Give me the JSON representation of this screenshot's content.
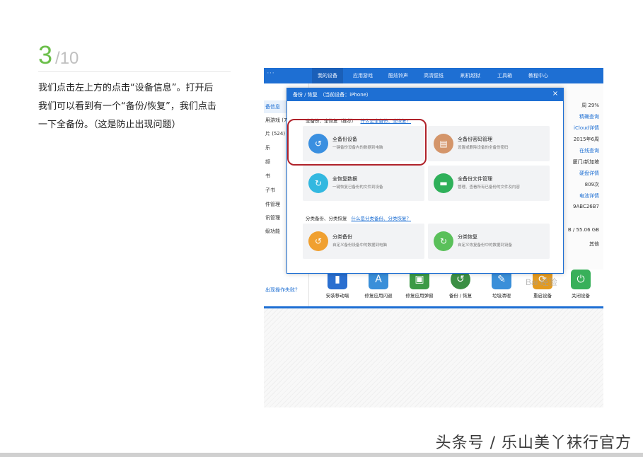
{
  "step": {
    "number": "3",
    "total": "/10"
  },
  "instruction_lines": [
    "我们点击左上方的点击“设备信息”。打开后",
    "我们可以看到有一个“备份/恢复”，我们点击",
    "一下全备份。（这是防止出现问题）"
  ],
  "app": {
    "nav": [
      "我的设备",
      "应用游戏",
      "酷炫铃声",
      "高清壁纸",
      "刷机越狱",
      "工具箱",
      "教程中心"
    ],
    "active_nav": "我的设备",
    "sidebar": [
      "备信息",
      "用游戏 (7...",
      "片 (524)",
      "乐",
      "频",
      "书",
      "子书",
      "件管理",
      "讯管理",
      "级功能"
    ],
    "sidebar_fail_link": "出现操作失败？",
    "right_info": [
      "周 29%",
      "精确查询",
      "iCloud详情",
      "2015年6周",
      "在线查询",
      "厦门/新加坡",
      "硬盘详情",
      "809次",
      "电池详情",
      "9ABC26B7",
      "B / 55.06 GB",
      "其他"
    ],
    "tools": [
      {
        "label": "安装移动端",
        "icon": "install-mobile-icon",
        "color": "#2a6fd0"
      },
      {
        "label": "修复应用闪退",
        "icon": "app-repair-icon",
        "color": "#3a8fd9"
      },
      {
        "label": "修复应用弹窗",
        "icon": "popup-repair-icon",
        "color": "#3c9a46"
      },
      {
        "label": "备份 / 恢复",
        "icon": "backup-restore-icon",
        "color": "#3b8f44"
      },
      {
        "label": "垃圾清理",
        "icon": "cleanup-icon",
        "color": "#3a8fd9"
      },
      {
        "label": "重启设备",
        "icon": "restart-icon",
        "color": "#e39a1f"
      },
      {
        "label": "关闭设备",
        "icon": "power-icon",
        "color": "#38b05a"
      }
    ]
  },
  "modal": {
    "title": "备份 / 恢复　（当前设备：iPhone）",
    "close": "×",
    "section1": {
      "label": "全备份、全恢复（推荐）",
      "help": "什么是全备份、全恢复？"
    },
    "section2": {
      "label": "分类备份、分类恢复",
      "help": "什么是分类备份、分类恢复？"
    },
    "cards": [
      {
        "title": "全备份设备",
        "desc": "一键备份设备内的数据到电脑",
        "icon": "full-backup-icon",
        "color": "#3a8fe0"
      },
      {
        "title": "全备份密码管理",
        "desc": "设置或删除设备的全备份密码",
        "icon": "password-lock-icon",
        "color": "#d4956a"
      },
      {
        "title": "全恢复数据",
        "desc": "一键恢复已备份的文件到设备",
        "icon": "full-restore-icon",
        "color": "#33b8e0"
      },
      {
        "title": "全备份文件管理",
        "desc": "管理、查看所有已备份的文件及内容",
        "icon": "folder-icon",
        "color": "#2fb05a"
      },
      {
        "title": "分类备份",
        "desc": "自定义备份设备中的数据到电脑",
        "icon": "category-backup-icon",
        "color": "#f0a030"
      },
      {
        "title": "分类恢复",
        "desc": "自定义恢复备份中的数据到设备",
        "icon": "category-restore-icon",
        "color": "#5ac05a"
      }
    ]
  },
  "watermark": "Bai 经验",
  "footer": "头条号 / 乐山美丫袜行官方"
}
